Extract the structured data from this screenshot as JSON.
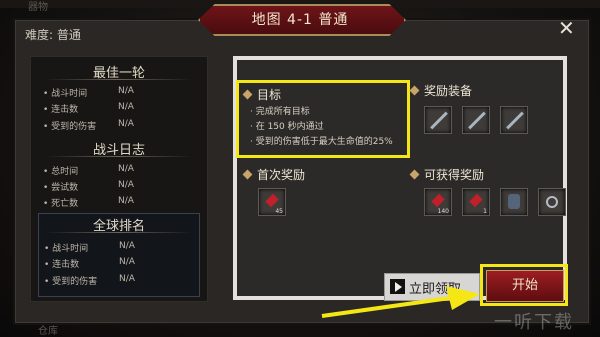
{
  "background": {
    "top_tab": "器物",
    "bottom_tab": "仓库"
  },
  "window": {
    "title": "地图 4-1 普通",
    "subtitle": "难度: 普通",
    "close_glyph": "✕"
  },
  "best_round": {
    "title": "最佳一轮",
    "rows": [
      {
        "label": "战斗时间",
        "value": "N/A"
      },
      {
        "label": "连击数",
        "value": "N/A"
      },
      {
        "label": "受到的伤害",
        "value": "N/A"
      }
    ]
  },
  "battle_log": {
    "title": "战斗日志",
    "rows": [
      {
        "label": "总时间",
        "value": "N/A"
      },
      {
        "label": "尝试数",
        "value": "N/A"
      },
      {
        "label": "死亡数",
        "value": "N/A"
      }
    ]
  },
  "global_rank": {
    "title": "全球排名",
    "rows": [
      {
        "label": "战斗时间",
        "value": "N/A"
      },
      {
        "label": "连击数",
        "value": "N/A"
      },
      {
        "label": "受到的伤害",
        "value": "N/A"
      }
    ]
  },
  "objectives": {
    "title": "目标",
    "lines": [
      "· 完成所有目标",
      "· 在 150 秒内通过",
      "· 受到的伤害低于最大生命值的25%"
    ]
  },
  "reward_equipment": {
    "title": "奖励装备",
    "items": [
      {
        "icon": "sword-icon"
      },
      {
        "icon": "sword-icon"
      },
      {
        "icon": "sword-icon"
      }
    ]
  },
  "first_reward": {
    "title": "首次奖励",
    "items": [
      {
        "icon": "ruby-icon",
        "qty": "45"
      }
    ]
  },
  "available_rewards": {
    "title": "可获得奖励",
    "items": [
      {
        "icon": "ruby-icon",
        "qty": "140"
      },
      {
        "icon": "ruby-icon",
        "qty": "1"
      },
      {
        "icon": "armor-icon",
        "qty": ""
      },
      {
        "icon": "ring-icon",
        "qty": ""
      }
    ]
  },
  "buttons": {
    "claim_label": "立即领取",
    "start_label": "开始"
  },
  "watermark": "一听下载",
  "colors": {
    "highlight": "#f5e615",
    "start_button": "#9c1e22",
    "title_band": "#6e1418"
  }
}
